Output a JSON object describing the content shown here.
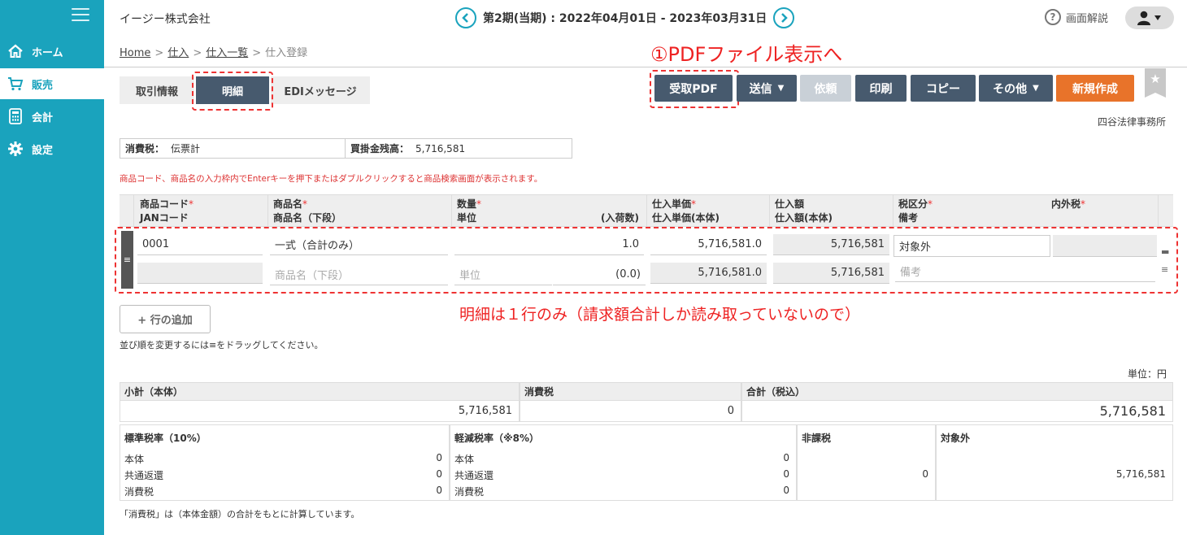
{
  "company": "イージー株式会社",
  "period": "第2期(当期) : 2022年04月01日 - 2023年03月31日",
  "help_label": "画面解説",
  "sidebar": {
    "items": [
      {
        "label": "ホーム",
        "icon": "home-icon"
      },
      {
        "label": "販売",
        "icon": "cart-icon"
      },
      {
        "label": "会計",
        "icon": "calculator-icon"
      },
      {
        "label": "設定",
        "icon": "gear-icon"
      }
    ]
  },
  "breadcrumb": [
    "Home",
    "仕入",
    "仕入一覧",
    "仕入登録"
  ],
  "tabs": [
    "取引情報",
    "明細",
    "EDIメッセージ"
  ],
  "actions": {
    "received_pdf": "受取PDF",
    "send": "送信",
    "request": "依頼",
    "print": "印刷",
    "copy": "コピー",
    "other": "その他",
    "new": "新規作成"
  },
  "client_name": "四谷法律事務所",
  "annotations": {
    "pdf": "①PDFファイル表示へ",
    "detail": "明細は１行のみ（請求額合計しか読み取っていないので）"
  },
  "info": {
    "tax_label": "消費税：",
    "tax_value": "伝票計",
    "balance_label": "買掛金残高：",
    "balance_value": "5,716,581"
  },
  "notice": "商品コード、商品名の入力枠内でEnterキーを押下またはダブルクリックすると商品検索画面が表示されます。",
  "table_headers": {
    "code": "商品コード",
    "jan": "JANコード",
    "name": "商品名",
    "name2": "商品名（下段）",
    "qty": "数量",
    "unit": "単位",
    "per_box": "(入荷数)",
    "price": "仕入単価",
    "price_body": "仕入単価(本体)",
    "amount": "仕入額",
    "amount_body": "仕入額(本体)",
    "tax_type": "税区分",
    "remarks": "備考",
    "inout_tax": "内外税",
    "required_mark": "*"
  },
  "row": {
    "code": "0001",
    "name": "一式（合計のみ）",
    "name2_placeholder": "商品名（下段）",
    "qty": "1.0",
    "unit_placeholder": "単位",
    "per_box": "(0.0)",
    "price": "5,716,581.0",
    "price_body": "5,716,581.0",
    "amount": "5,716,581",
    "amount_body": "5,716,581",
    "tax_type": "対象外",
    "remarks_placeholder": "備考"
  },
  "add_row": "+ 行の追加",
  "sort_note": "並び順を変更するには≡をドラッグしてください。",
  "unit_label": "単位：円",
  "totals": {
    "subtotal_label": "小計（本体）",
    "subtotal": "5,716,581",
    "tax_label": "消費税",
    "tax": "0",
    "total_label": "合計（税込）",
    "total": "5,716,581"
  },
  "tax_breakdown": {
    "standard": {
      "title": "標準税率（10%）",
      "rows": [
        [
          "本体",
          "0"
        ],
        [
          "共通返還",
          "0"
        ],
        [
          "消費税",
          "0"
        ]
      ]
    },
    "reduced": {
      "title": "軽減税率（※8%）",
      "rows": [
        [
          "本体",
          "0"
        ],
        [
          "共通返還",
          "0"
        ],
        [
          "消費税",
          "0"
        ]
      ]
    },
    "exempt": {
      "title": "非課税",
      "value": "0"
    },
    "excluded": {
      "title": "対象外",
      "value": "5,716,581"
    }
  },
  "foot_note": "「消費税」は（本体金額）の合計をもとに計算しています。"
}
